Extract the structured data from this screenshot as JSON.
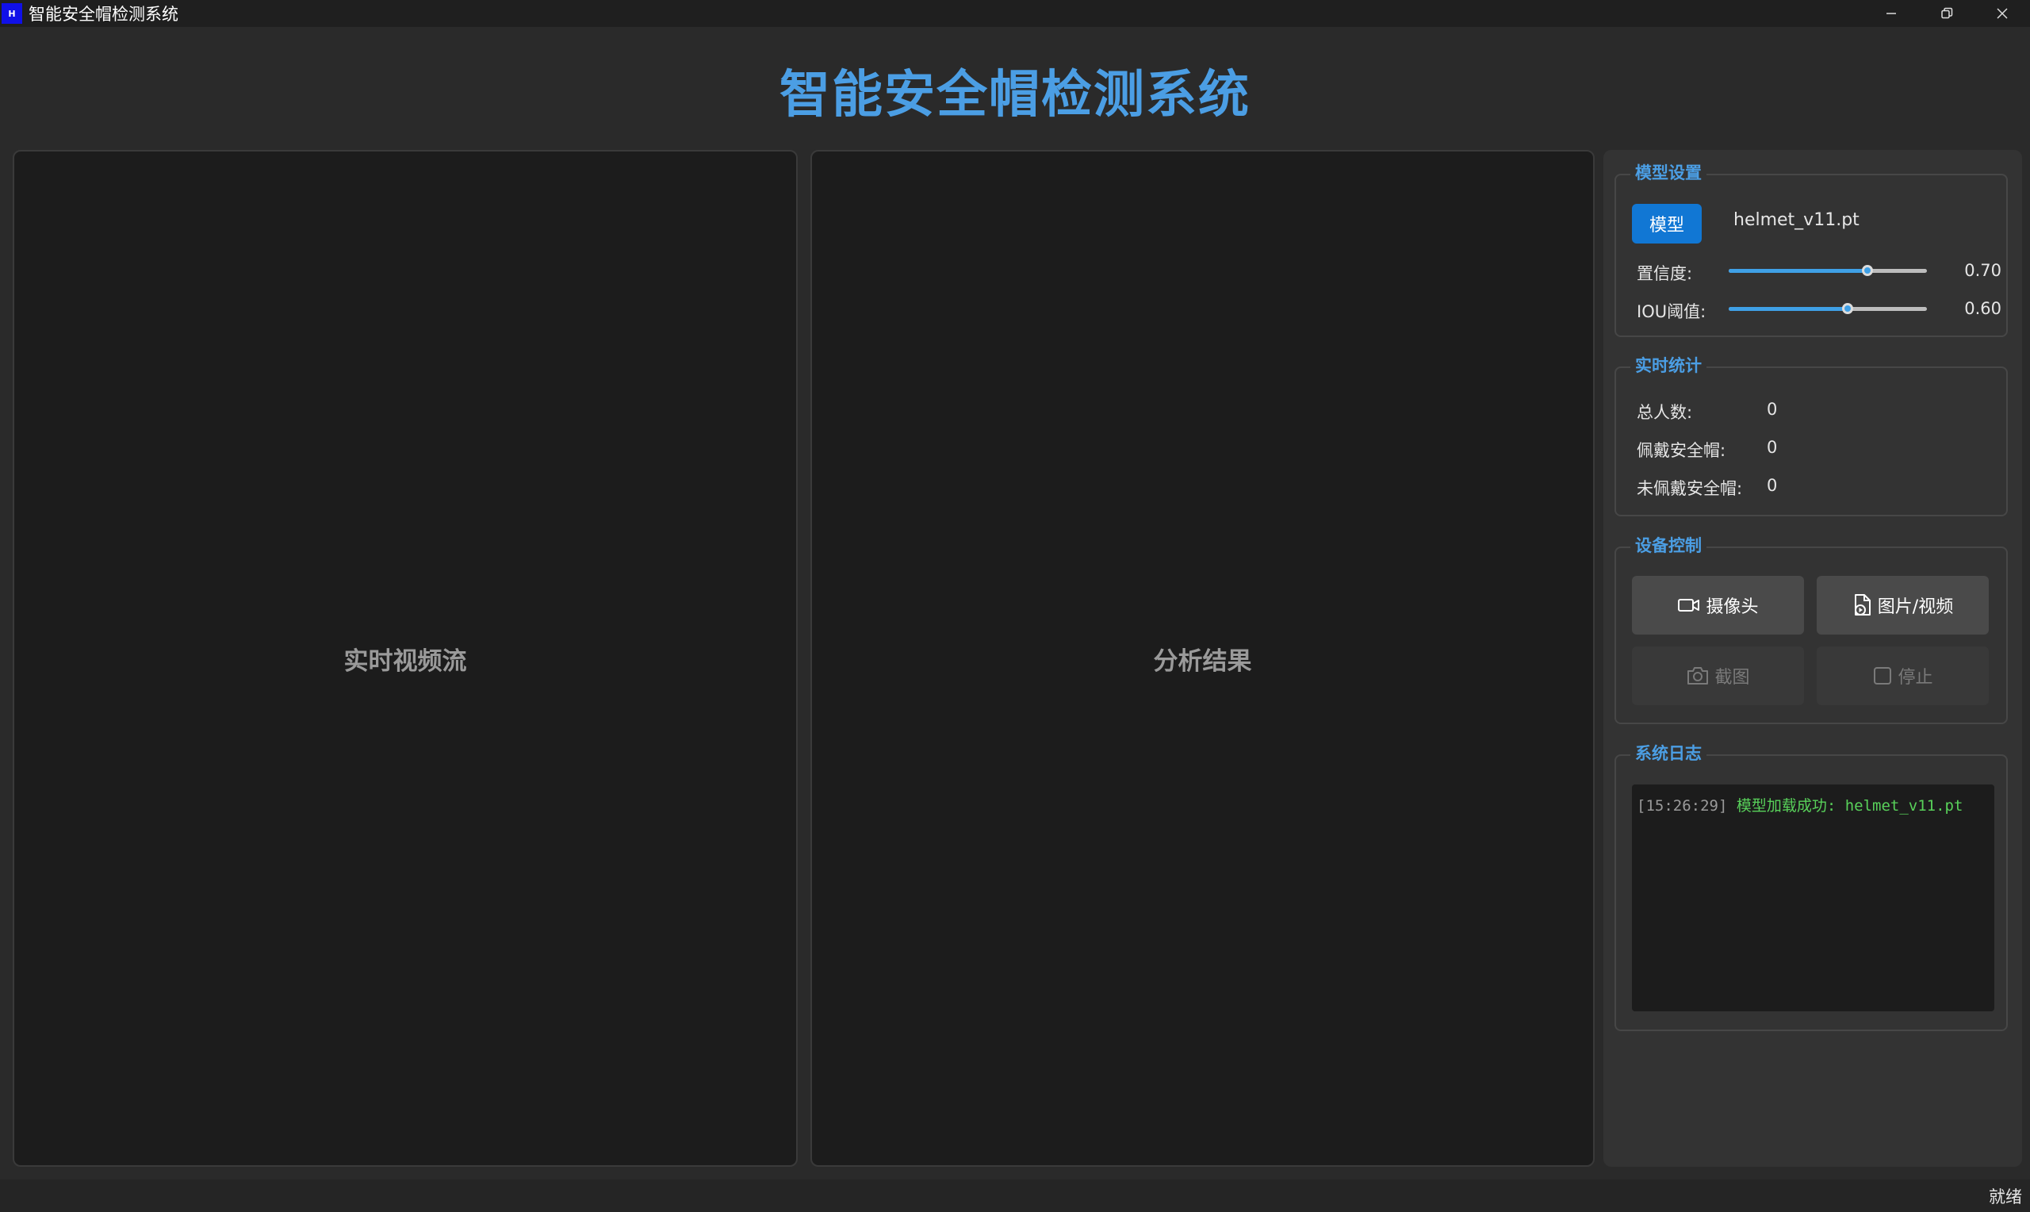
{
  "window": {
    "icon_text": "H",
    "title": "智能安全帽检测系统"
  },
  "header": {
    "title": "智能安全帽检测系统"
  },
  "panels": {
    "left_label": "实时视频流",
    "right_label": "分析结果"
  },
  "model_settings": {
    "title": "模型设置",
    "model_button": "模型",
    "model_file": "helmet_v11.pt",
    "confidence": {
      "label": "置信度:",
      "value": "0.70",
      "fraction": 0.7
    },
    "iou": {
      "label": "IOU阈值:",
      "value": "0.60",
      "fraction": 0.6
    }
  },
  "stats": {
    "title": "实时统计",
    "rows": [
      {
        "label": "总人数:",
        "value": "0"
      },
      {
        "label": "佩戴安全帽:",
        "value": "0"
      },
      {
        "label": "未佩戴安全帽:",
        "value": "0"
      }
    ]
  },
  "device": {
    "title": "设备控制",
    "camera": "摄像头",
    "media": "图片/视频",
    "screenshot": "截图",
    "stop": "停止"
  },
  "log": {
    "title": "系统日志",
    "entries": [
      {
        "time": "[15:26:29]",
        "message": "模型加载成功: helmet_v11.pt"
      }
    ]
  },
  "status": {
    "text": "就绪"
  },
  "colors": {
    "accent": "#4b9ee4",
    "primary_button": "#1177d4",
    "log_success": "#58d15a"
  }
}
